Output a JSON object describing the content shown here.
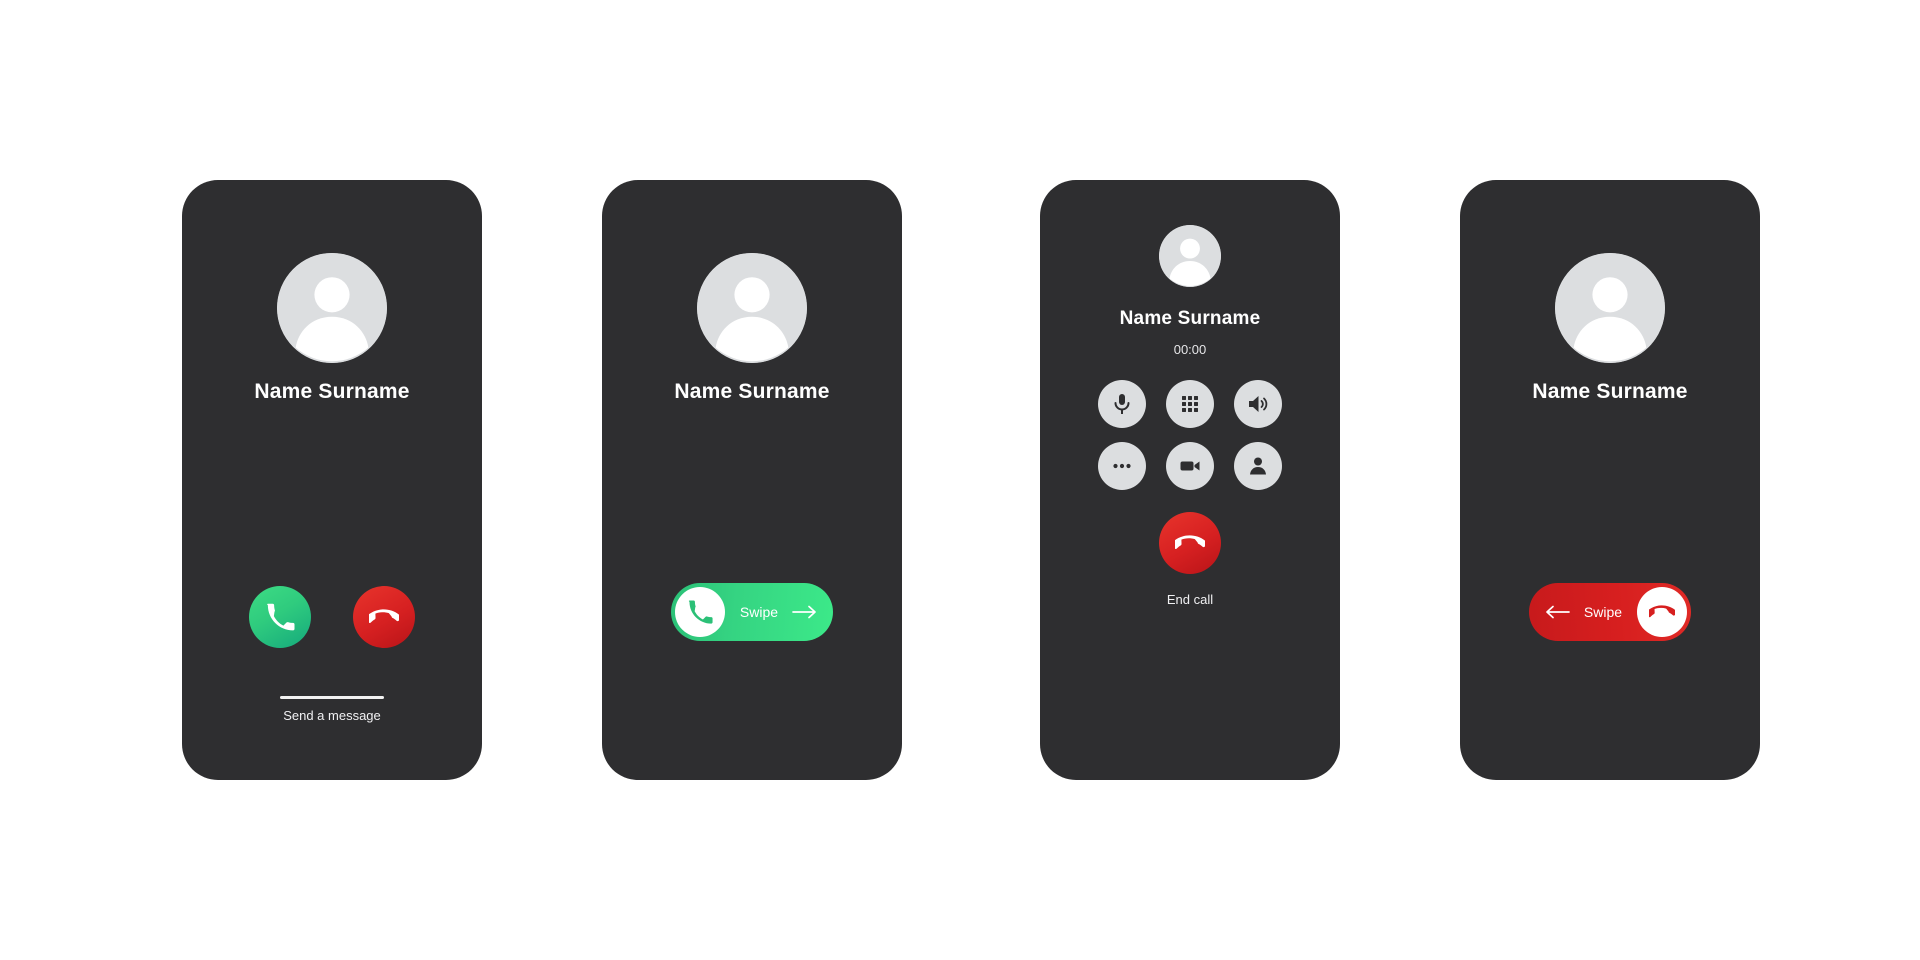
{
  "meta": {
    "background_color": "#ffffff",
    "card_color": "#2e2e30",
    "accent_green": "#35d482",
    "accent_red": "#d62021",
    "avatar_color": "#dcdee0"
  },
  "screens": [
    {
      "id": "incoming-call-buttons",
      "contact_name": "Name Surname",
      "avatar_icon": "user-avatar-icon",
      "accept_icon": "phone-handset-icon",
      "decline_icon": "phone-hangup-icon",
      "send_message_label": "Send a message",
      "home_indicator": "home-indicator-bar"
    },
    {
      "id": "incoming-call-swipe-accept",
      "contact_name": "Name Surname",
      "avatar_icon": "user-avatar-icon",
      "swipe_label": "Swipe",
      "swipe_icon": "phone-handset-icon",
      "swipe_arrow_icon": "arrow-right-icon"
    },
    {
      "id": "active-call-controls",
      "contact_name": "Name Surname",
      "call_duration": "00:00",
      "avatar_icon": "user-avatar-icon",
      "controls": [
        {
          "name": "mute",
          "icon": "microphone-icon"
        },
        {
          "name": "keypad",
          "icon": "dialpad-icon"
        },
        {
          "name": "speaker",
          "icon": "speaker-icon"
        },
        {
          "name": "more",
          "icon": "more-dots-icon"
        },
        {
          "name": "video",
          "icon": "video-camera-icon"
        },
        {
          "name": "add-contact",
          "icon": "person-icon"
        }
      ],
      "end_call_label": "End call",
      "end_call_icon": "phone-hangup-icon"
    },
    {
      "id": "incoming-call-swipe-decline",
      "contact_name": "Name Surname",
      "avatar_icon": "user-avatar-icon",
      "swipe_label": "Swipe",
      "swipe_icon": "phone-hangup-icon",
      "swipe_arrow_icon": "arrow-left-icon"
    }
  ]
}
